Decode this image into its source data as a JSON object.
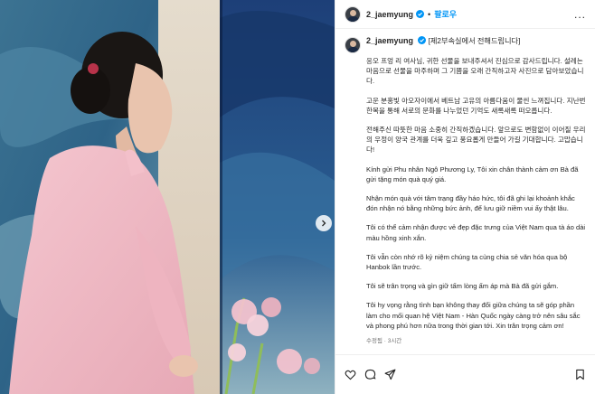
{
  "post": {
    "author": "2_jaemyung",
    "follow_label": "팔로우",
    "more_label": "...",
    "caption_prefix": "[제2부속실에서 전해드립니다]",
    "paragraphs": [
      "응오 프엉 리 여사님, 귀한 선물을 보내주셔서 진심으로 감사드립니다. 설레는 마음으로 선물을 마주하며 그 기쁨을 오래 간직하고자 사진으로 담아보았습니다.",
      "고운 분홍빛 아오자이에서 베트남 고유의 아름다움이 물씬 느껴집니다. 지난번 한복을 통해 서로의 문화를 나누었던 기억도 새록새록 떠오릅니다.",
      "전해주신 따뜻한 마음 소중히 간직하겠습니다. 앞으로도 변함없이 이어질 우리의 우정이 양국 관계를 더욱 깊고 풍요롭게 만들어 가길 기대합니다. 고맙습니다!",
      "Kính gửi Phu nhân Ngô Phương Ly, Tôi xin chân thành cảm ơn Bà đã gửi tặng món quà quý giá.",
      "Nhận món quà với tâm trạng đầy háo hức, tôi đã ghi lại khoảnh khắc đón nhận nó bằng những bức ảnh, để lưu giữ niềm vui ấy thật lâu.",
      "Tôi có thể cảm nhận được vẻ đẹp đặc trưng của Việt Nam qua tà áo dài màu hồng xinh xắn.",
      "Tôi vẫn còn nhớ rõ kỷ niệm chúng ta cùng chia sẻ văn hóa qua bộ Hanbok lần trước.",
      "Tôi sẽ trân trọng và gìn giữ tấm lòng ấm áp mà Bà đã gửi gắm.",
      "Tôi hy vọng rằng tình bạn không thay đổi giữa chúng ta sẽ góp phần làm cho mối quan hệ Việt Nam - Hàn Quốc ngày càng trở nên sâu sắc và phong phú hơn nữa trong thời gian tới. Xin trân trọng cảm ơn!"
    ],
    "meta": "수정됨 · 3시간"
  },
  "icons": {
    "verified": "verified-badge-icon",
    "next": "chevron-right-icon",
    "like": "heart-icon",
    "comment": "comment-icon",
    "share": "send-icon",
    "save": "bookmark-icon"
  },
  "colors": {
    "accent": "#0095f6",
    "verified": "#0095f6",
    "text": "#262626",
    "muted": "#737373"
  }
}
